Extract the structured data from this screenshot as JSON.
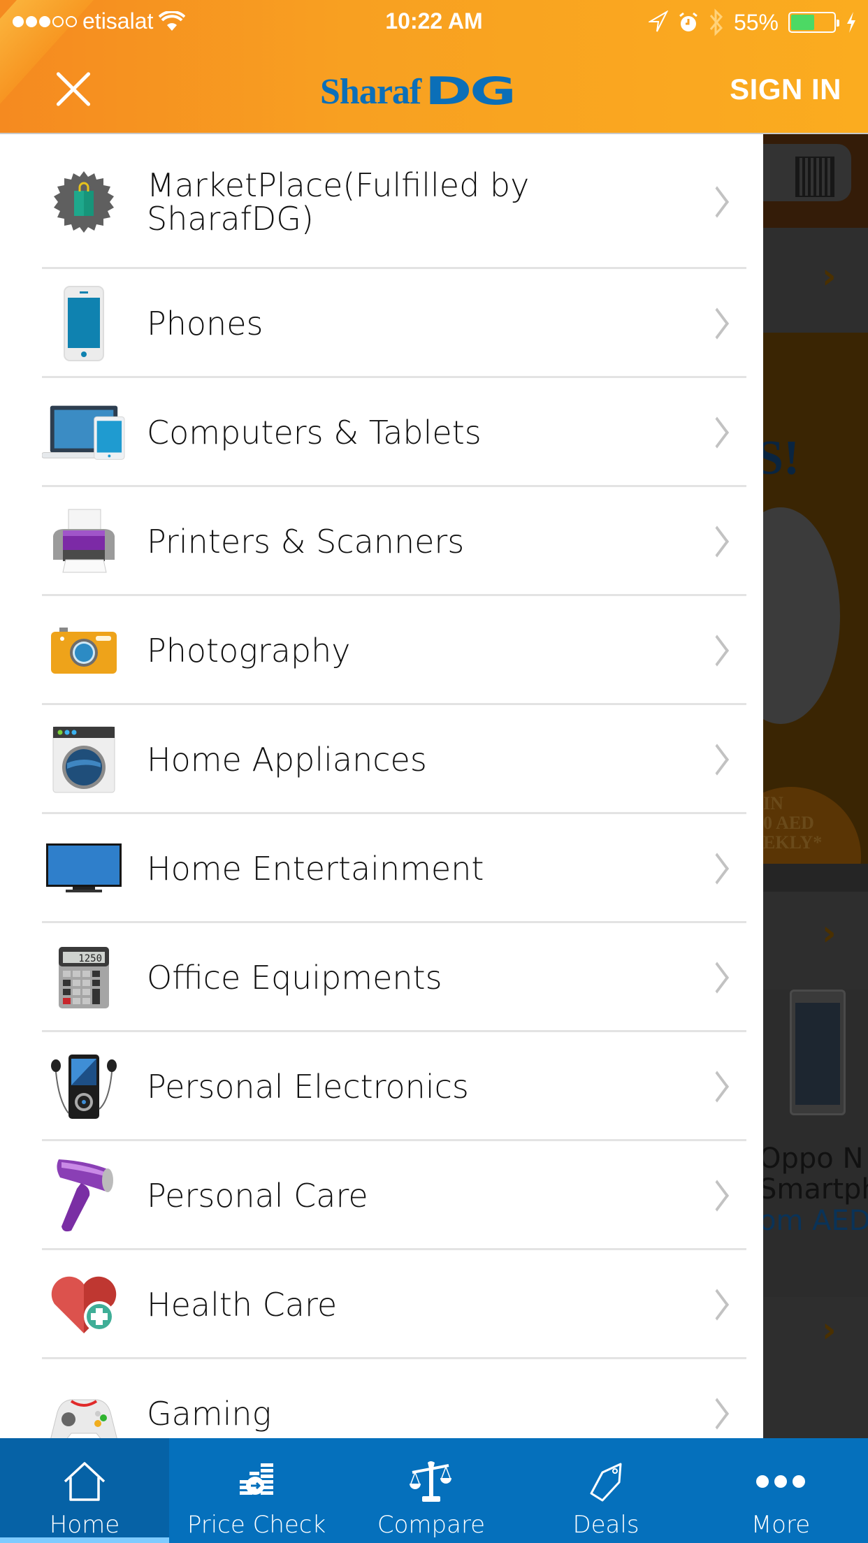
{
  "status_bar": {
    "carrier": "etisalat",
    "signal_bars_filled": 3,
    "signal_bars_total": 5,
    "time": "10:22 AM",
    "battery_percent_label": "55%",
    "battery_level": 0.55,
    "icons": [
      "wifi-icon",
      "location-arrow-icon",
      "alarm-icon",
      "bluetooth-icon",
      "battery-icon",
      "charging-bolt-icon"
    ]
  },
  "header": {
    "close_icon": "close-icon",
    "logo_text_1": "Sharaf",
    "logo_text_2": "DG",
    "sign_in_label": "SIGN IN",
    "brand_color": "#0b6fb8",
    "header_color": "#f8a021"
  },
  "menu": {
    "items": [
      {
        "label": "MarketPlace(Fulfilled by SharafDG)",
        "icon": "shopping-bag-badge-icon"
      },
      {
        "label": "Phones",
        "icon": "smartphone-icon"
      },
      {
        "label": "Computers & Tablets",
        "icon": "laptop-tablet-icon"
      },
      {
        "label": "Printers & Scanners",
        "icon": "printer-icon"
      },
      {
        "label": "Photography",
        "icon": "camera-icon"
      },
      {
        "label": "Home Appliances",
        "icon": "washing-machine-icon"
      },
      {
        "label": "Home Entertainment",
        "icon": "television-icon"
      },
      {
        "label": "Office Equipments",
        "icon": "calculator-icon"
      },
      {
        "label": "Personal Electronics",
        "icon": "media-player-icon"
      },
      {
        "label": "Personal Care",
        "icon": "hair-dryer-icon"
      },
      {
        "label": "Health Care",
        "icon": "heart-plus-icon"
      },
      {
        "label": "Gaming",
        "icon": "gamepad-icon"
      }
    ],
    "calculator_display": "1250"
  },
  "background": {
    "banner_text": "S!",
    "badge_lines": [
      "IN",
      "0 AED",
      "EKLY*"
    ],
    "product_name_lines": [
      "Oppo N",
      "Smartph"
    ],
    "product_price": "om AED"
  },
  "tabbar": {
    "tabs": [
      {
        "label": "Home",
        "icon": "home-icon",
        "active": true
      },
      {
        "label": "Price Check",
        "icon": "price-check-icon",
        "active": false
      },
      {
        "label": "Compare",
        "icon": "scales-icon",
        "active": false
      },
      {
        "label": "Deals",
        "icon": "tag-icon",
        "active": false
      },
      {
        "label": "More",
        "icon": "more-dots-icon",
        "active": false
      }
    ],
    "color": "#0570bc",
    "active_indicator_color": "#7ecbff"
  }
}
